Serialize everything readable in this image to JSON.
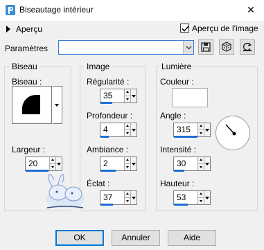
{
  "window": {
    "title": "Biseautage intérieur",
    "close_glyph": "✕"
  },
  "preview": {
    "toggle_label": "Aperçu",
    "checkbox_label": "Aperçu de l'image",
    "checked": true
  },
  "params": {
    "label": "Paramètres",
    "value": ""
  },
  "tool_icons": [
    "save-preset-icon",
    "random-dice-icon",
    "reset-icon"
  ],
  "bevel": {
    "group_title": "Biseau",
    "bevel_label": "Biseau :",
    "width_label": "Largeur :",
    "width_value": "20"
  },
  "image": {
    "group_title": "Image",
    "smoothness_label": "Régularité :",
    "smoothness_value": "35",
    "depth_label": "Profondeur :",
    "depth_value": "4",
    "ambience_label": "Ambiance :",
    "ambience_value": "2",
    "shine_label": "Éclat :",
    "shine_value": "37"
  },
  "light": {
    "group_title": "Lumière",
    "color_label": "Couleur :",
    "color_value": "#ffffff",
    "angle_label": "Angle :",
    "angle_value": "315",
    "intensity_label": "Intensité :",
    "intensity_value": "30",
    "elevation_label": "Hauteur :",
    "elevation_value": "53"
  },
  "buttons": {
    "ok": "OK",
    "cancel": "Annuler",
    "help": "Aide"
  },
  "colors": {
    "accent": "#1c6fd6",
    "bg": "#f0f0f0"
  }
}
